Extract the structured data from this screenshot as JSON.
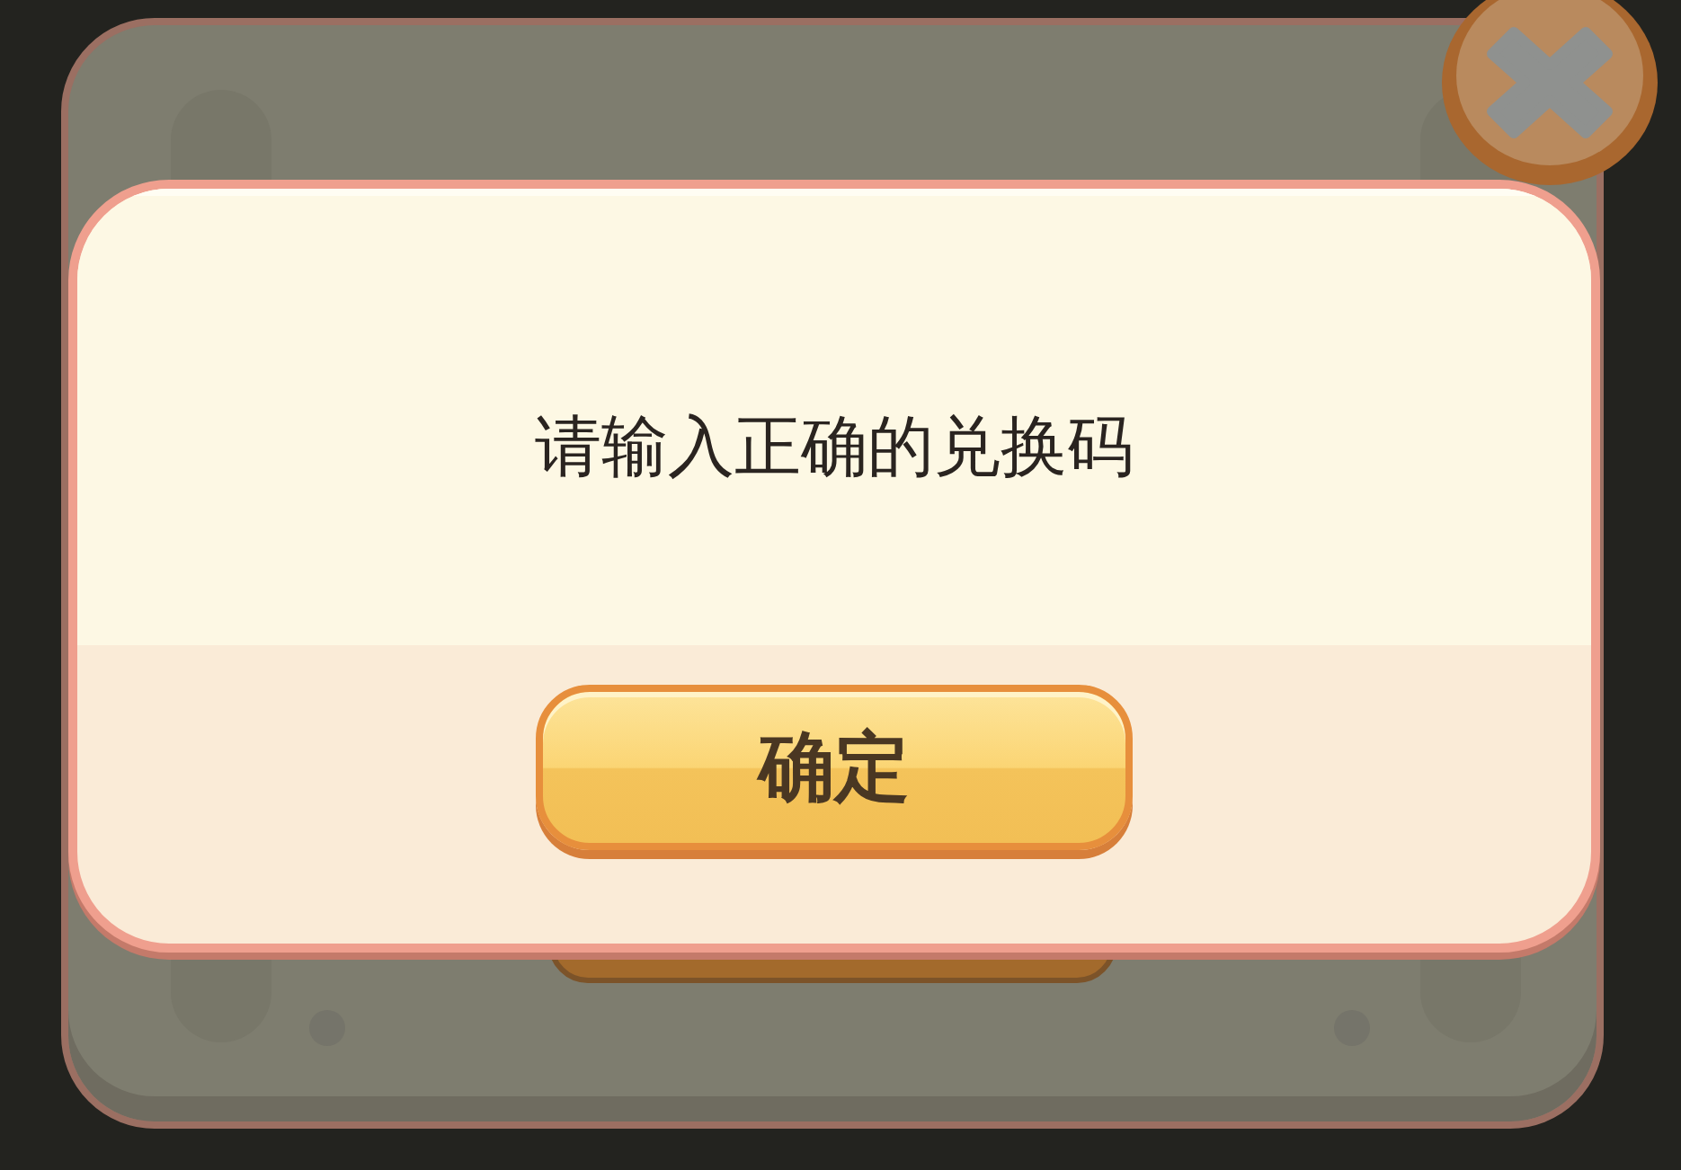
{
  "dialog": {
    "message": "请输入正确的兑换码",
    "confirm_button": {
      "label": "确定"
    }
  }
}
